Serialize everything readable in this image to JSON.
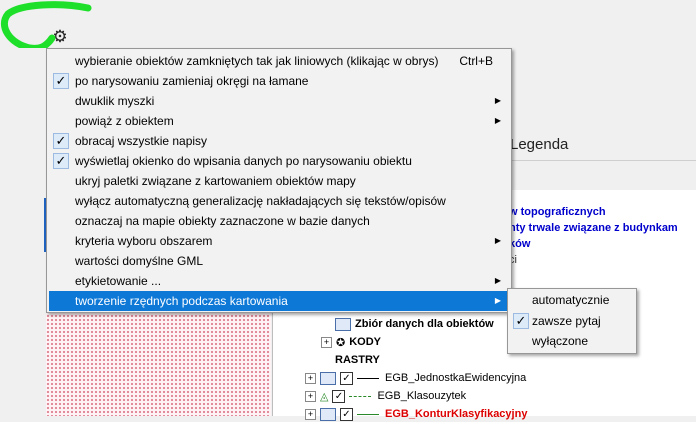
{
  "toolbar": {
    "settings_icon": "gear-icon"
  },
  "background": {
    "tab_legenda": "Legenda",
    "layer_texts": [
      "w topograficznych",
      "nty trwale związane z budynkam",
      "ków",
      "ci"
    ],
    "tree": [
      {
        "label": "Zbiór danych dla obiektów",
        "style": "bold",
        "icon": "dataset-icon"
      },
      {
        "label": "KODY",
        "style": "bold",
        "icon": "code-icon"
      },
      {
        "label": "RASTRY",
        "style": "bold",
        "icon": ""
      },
      {
        "label": "EGB_JednostkaEwidencyjna",
        "style": "normal",
        "icon": "layer-icon"
      },
      {
        "label": "EGB_Klasouzytek",
        "style": "normal",
        "icon": "layer-icon"
      },
      {
        "label": "EGB_KonturKlasyfikacyjny",
        "style": "red",
        "icon": "layer-icon"
      }
    ]
  },
  "context_menu": {
    "items": [
      {
        "label": "wybieranie obiektów zamkniętych tak jak liniowych (klikając w obrys)",
        "shortcut": "Ctrl+B",
        "checked": false,
        "submenu": false
      },
      {
        "label": "po narysowaniu zamieniaj okręgi na łamane",
        "shortcut": "",
        "checked": true,
        "submenu": false
      },
      {
        "label": "dwuklik myszki",
        "shortcut": "",
        "checked": false,
        "submenu": true
      },
      {
        "label": "powiąż z obiektem",
        "shortcut": "",
        "checked": false,
        "submenu": true
      },
      {
        "label": "obracaj wszystkie napisy",
        "shortcut": "",
        "checked": true,
        "submenu": false
      },
      {
        "label": "wyświetlaj okienko do wpisania danych po narysowaniu obiektu",
        "shortcut": "",
        "checked": true,
        "submenu": false
      },
      {
        "label": "ukryj paletki związane z kartowaniem obiektów mapy",
        "shortcut": "",
        "checked": false,
        "submenu": false
      },
      {
        "label": "wyłącz automatyczną generalizację nakładających się tekstów/opisów",
        "shortcut": "",
        "checked": false,
        "submenu": false
      },
      {
        "label": "oznaczaj na mapie obiekty zaznaczone w bazie danych",
        "shortcut": "",
        "checked": false,
        "submenu": false
      },
      {
        "label": "kryteria wyboru obszarem",
        "shortcut": "",
        "checked": false,
        "submenu": true
      },
      {
        "label": "wartości domyślne GML",
        "shortcut": "",
        "checked": false,
        "submenu": false
      },
      {
        "label": "etykietowanie ...",
        "shortcut": "",
        "checked": false,
        "submenu": true
      },
      {
        "label": "tworzenie rzędnych podczas kartowania",
        "shortcut": "",
        "checked": false,
        "submenu": true,
        "highlighted": true
      }
    ]
  },
  "submenu": {
    "items": [
      {
        "label": "automatycznie",
        "checked": false
      },
      {
        "label": "zawsze pytaj",
        "checked": true
      },
      {
        "label": "wyłączone",
        "checked": false
      }
    ]
  },
  "colors": {
    "highlight": "#0e78d7",
    "annotation": "#1ee02a",
    "layer_text": "#0000cc",
    "error_text": "#dd0000"
  }
}
